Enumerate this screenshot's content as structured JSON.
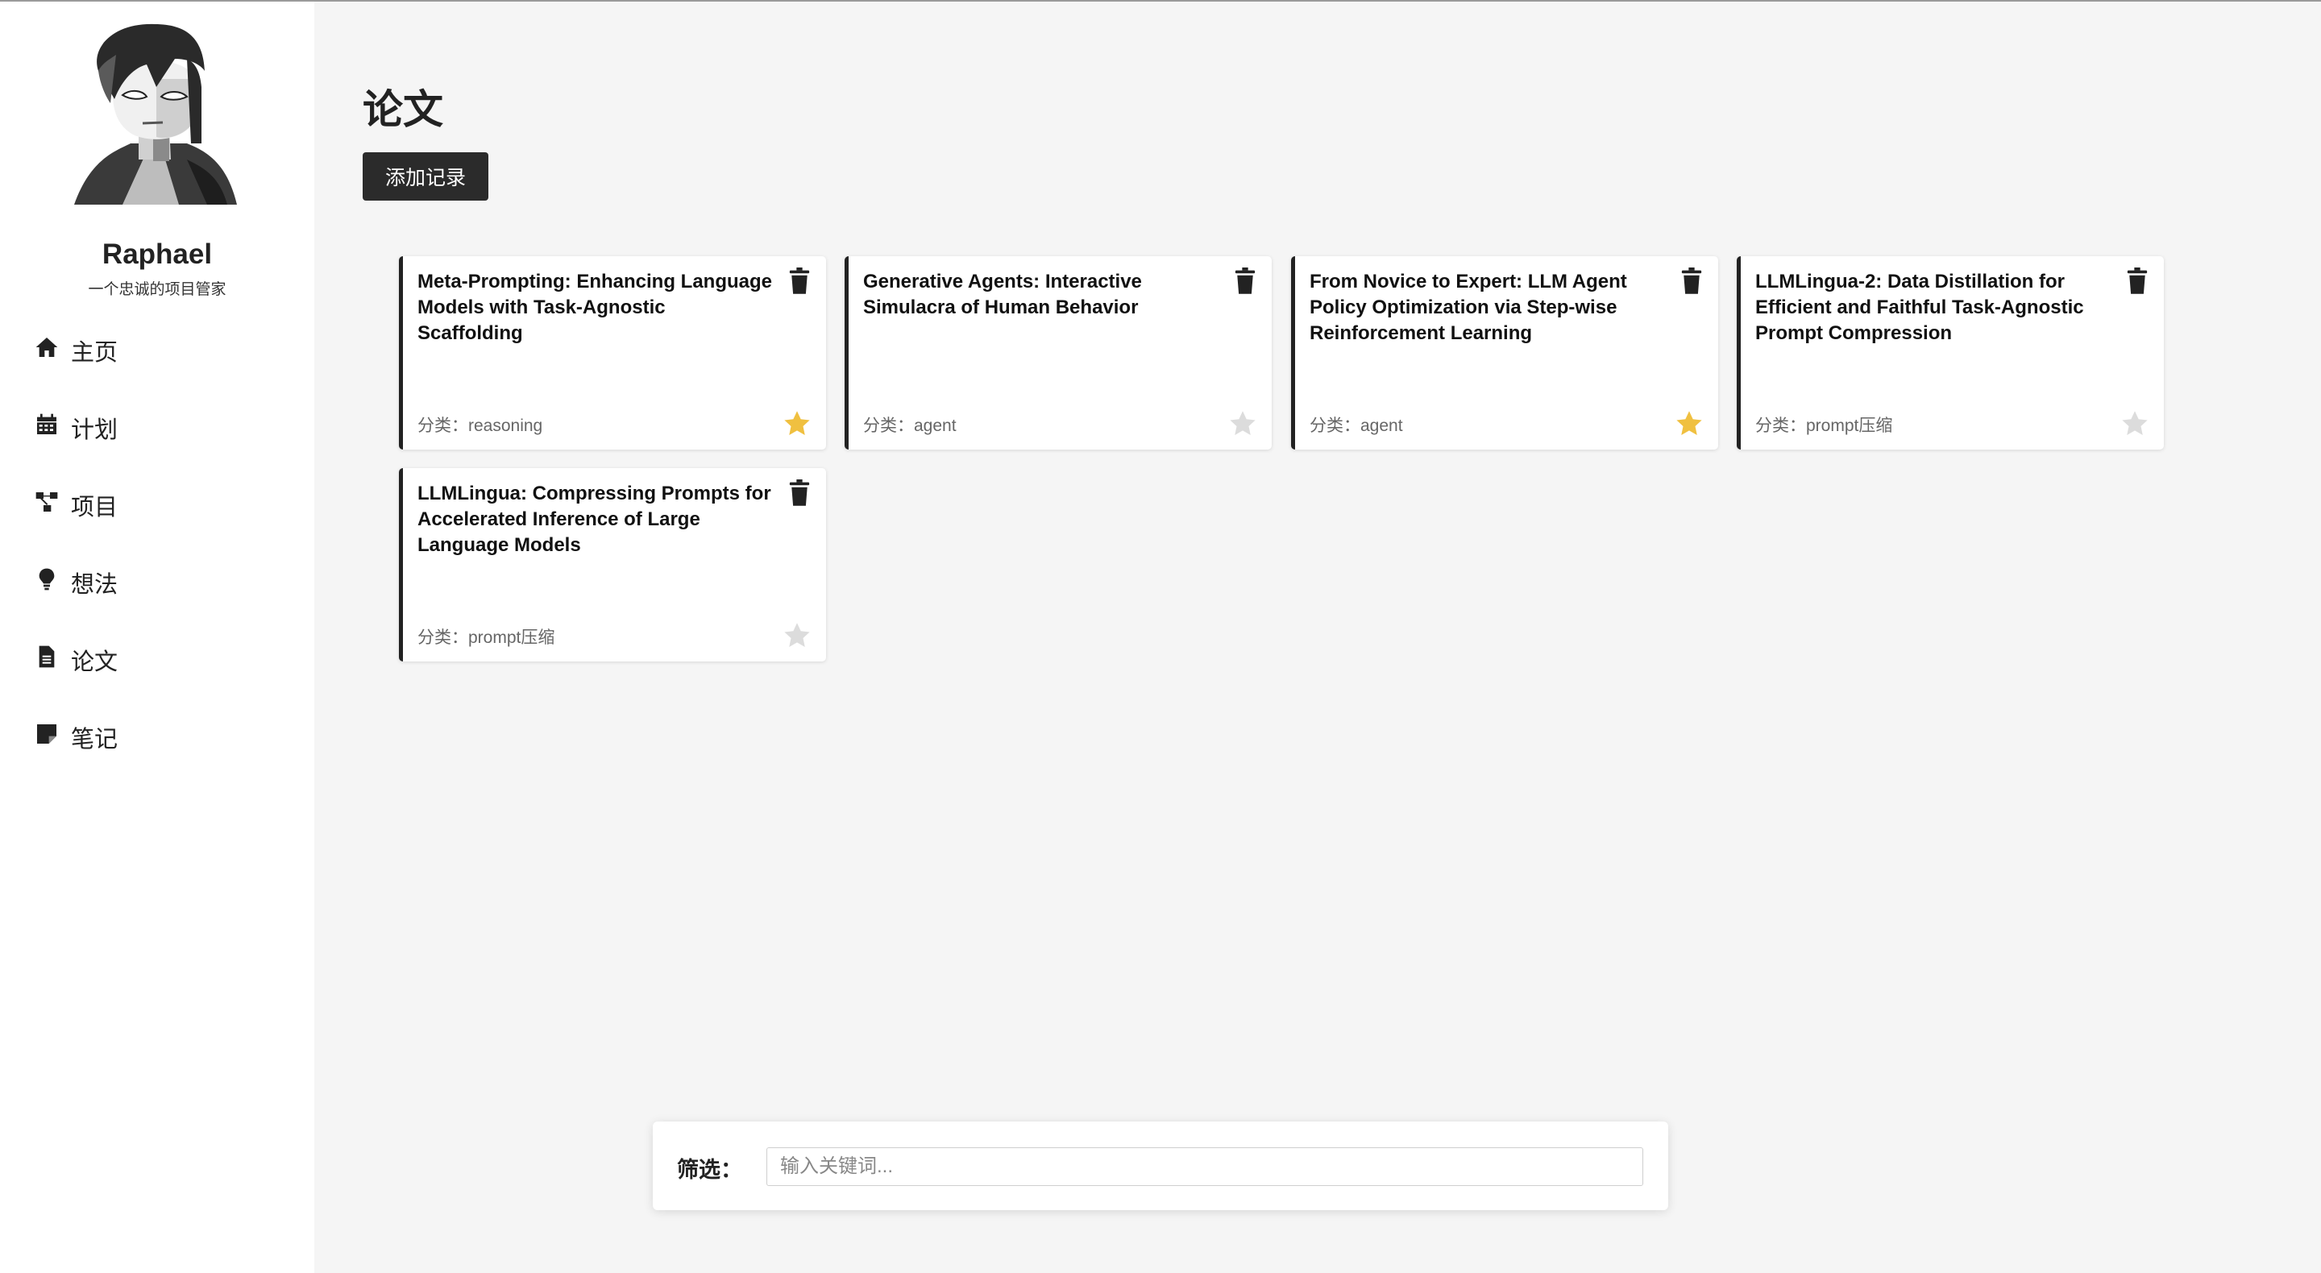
{
  "profile": {
    "name": "Raphael",
    "subtitle": "一个忠诚的项目管家"
  },
  "nav": [
    {
      "label": "主页",
      "icon": "home-icon"
    },
    {
      "label": "计划",
      "icon": "calendar-icon"
    },
    {
      "label": "项目",
      "icon": "project-tree-icon"
    },
    {
      "label": "想法",
      "icon": "lightbulb-icon"
    },
    {
      "label": "论文",
      "icon": "document-icon"
    },
    {
      "label": "笔记",
      "icon": "note-icon"
    }
  ],
  "page": {
    "title": "论文",
    "add_button": "添加记录"
  },
  "papers": [
    {
      "title": "Meta-Prompting: Enhancing Language Models with Task-Agnostic Scaffolding",
      "category": "分类：reasoning",
      "starred": true
    },
    {
      "title": "Generative Agents: Interactive Simulacra of Human Behavior",
      "category": "分类：agent",
      "starred": false
    },
    {
      "title": "From Novice to Expert: LLM Agent Policy Optimization via Step-wise Reinforcement Learning",
      "category": "分类：agent",
      "starred": true
    },
    {
      "title": "LLMLingua-2: Data Distillation for Efficient and Faithful Task-Agnostic Prompt Compression",
      "category": "分类：prompt压缩",
      "starred": false
    },
    {
      "title": "LLMLingua: Compressing Prompts for Accelerated Inference of Large Language Models",
      "category": "分类：prompt压缩",
      "starred": false
    }
  ],
  "filter": {
    "label": "筛选：",
    "placeholder": "输入关键词...",
    "value": ""
  },
  "colors": {
    "star_active": "#f0c040",
    "star_inactive": "#dcdcdc",
    "accent_dark": "#2b2b2b",
    "background": "#f5f5f5"
  }
}
